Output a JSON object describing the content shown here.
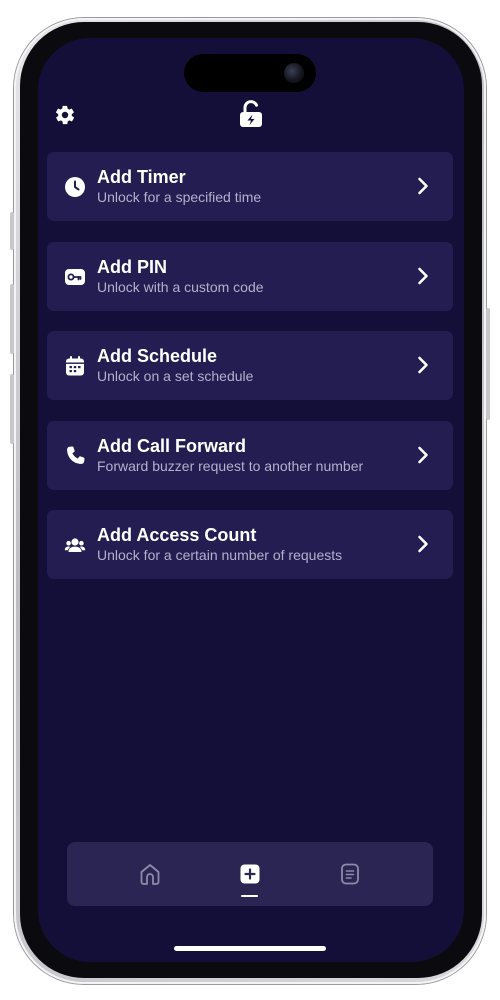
{
  "header": {
    "settings_icon": "gear-icon",
    "center_icon": "unlock-bolt-icon"
  },
  "menu": {
    "items": [
      {
        "title": "Add Timer",
        "subtitle": "Unlock for a specified time",
        "icon": "clock-icon"
      },
      {
        "title": "Add PIN",
        "subtitle": "Unlock with a custom code",
        "icon": "key-icon"
      },
      {
        "title": "Add Schedule",
        "subtitle": "Unlock on a set schedule",
        "icon": "calendar-icon"
      },
      {
        "title": "Add Call Forward",
        "subtitle": "Forward buzzer request to another number",
        "icon": "phone-icon"
      },
      {
        "title": "Add Access Count",
        "subtitle": "Unlock for a certain number of requests",
        "icon": "users-icon"
      }
    ]
  },
  "tabbar": {
    "tabs": [
      {
        "icon": "home-icon",
        "active": false
      },
      {
        "icon": "plus-square-icon",
        "active": true
      },
      {
        "icon": "document-icon",
        "active": false
      }
    ]
  },
  "colors": {
    "background": "#140f38",
    "card": "#231d52",
    "tabbar": "#2a2552",
    "text": "#ffffff",
    "subtext": "#b4b0cc",
    "inactive_icon": "#8e8aa8"
  }
}
